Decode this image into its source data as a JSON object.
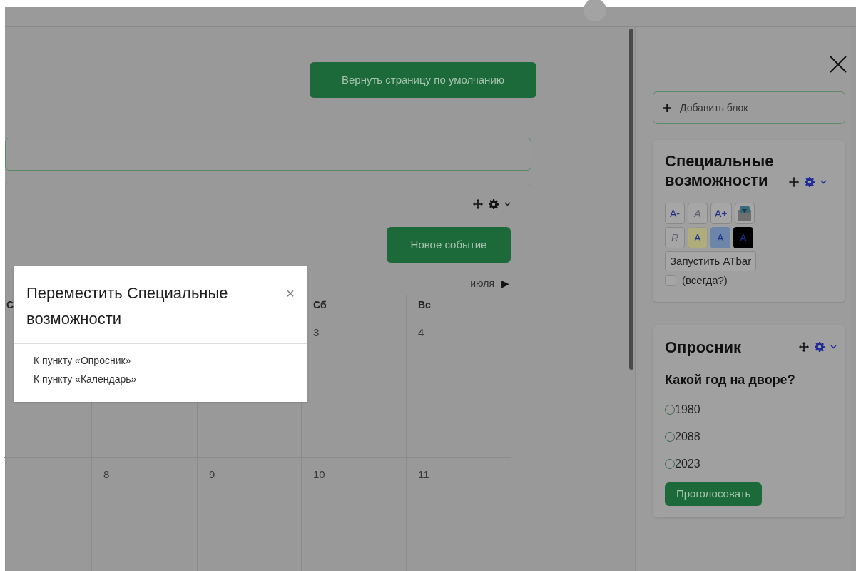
{
  "reset_button": "Вернуть страницу по умолчанию",
  "calendar": {
    "new_event_button": "Новое событие",
    "next_month": "июля",
    "next_arrow": "▶",
    "columns": [
      {
        "header": "С"
      },
      {},
      {},
      {
        "header": "Сб"
      },
      {
        "header": "Вс"
      }
    ],
    "rows": [
      {
        "cells": [
          null,
          null,
          null,
          "3",
          "4"
        ]
      },
      {
        "cells": [
          null,
          "8",
          "9",
          "10",
          "11"
        ]
      }
    ]
  },
  "move_dialog": {
    "title": "Переместить Специальные возможности",
    "close": "×",
    "targets": [
      "К пункту «Опросник»",
      "К пункту «Календарь»"
    ]
  },
  "sidebar": {
    "add_block": "Добавить блок",
    "accessibility": {
      "title": "Специальные возможности",
      "tools": [
        [
          {
            "label": "A-",
            "kind": "text"
          },
          {
            "label": "A",
            "kind": "off"
          },
          {
            "label": "A+",
            "kind": "text"
          },
          {
            "kind": "picture"
          }
        ],
        [
          {
            "label": "R",
            "kind": "off"
          },
          {
            "label": "A",
            "kind": "yellow"
          },
          {
            "label": "A",
            "kind": "blue"
          },
          {
            "label": "A",
            "kind": "black"
          }
        ]
      ],
      "atbar_button": "Запустить ATbar",
      "always": {
        "label": "(всегда?)",
        "checked": false
      }
    },
    "poll": {
      "title": "Опросник",
      "question": "Какой год на дворе?",
      "options": [
        {
          "label": "1980",
          "selected": false
        },
        {
          "label": "2088",
          "selected": false
        },
        {
          "label": "2023",
          "selected": false
        }
      ],
      "vote_button": "Проголосовать"
    }
  }
}
